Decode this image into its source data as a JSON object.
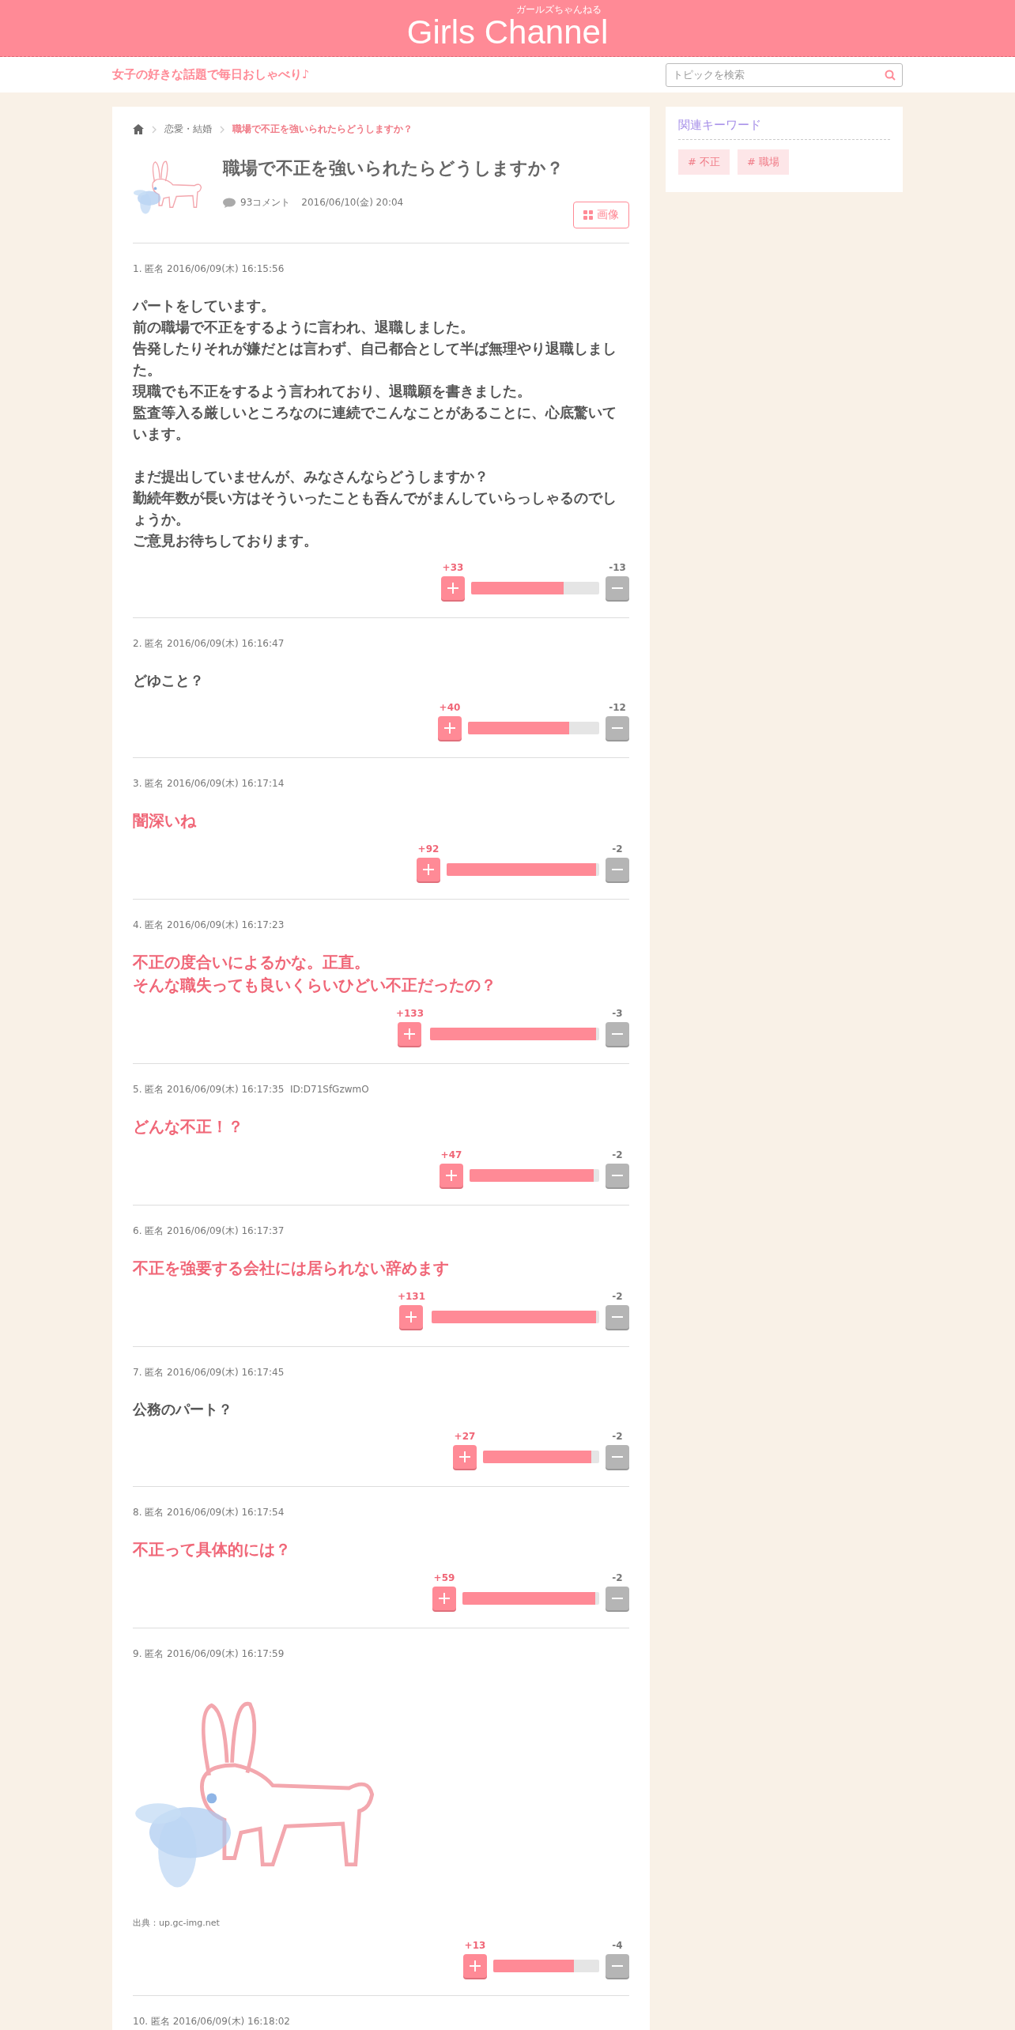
{
  "header": {
    "logo": "Girls Channel",
    "logo_kana": "ガールズちゃんねる",
    "tagline": "女子の好きな話題で毎日おしゃべり♪",
    "search": {
      "placeholder": "トピックを検索"
    }
  },
  "breadcrumb": [
    {
      "label": "恋愛・結婚",
      "current": false
    },
    {
      "label": "職場で不正を強いられたらどうしますか？",
      "current": true
    }
  ],
  "topic": {
    "title": "職場で不正を強いられたらどうしますか？",
    "comment_count": "93コメント",
    "date": "2016/06/10(金) 20:04",
    "image_button": "画像"
  },
  "comments": [
    {
      "kind": "text",
      "meta": "1. 匿名 2016/06/09(木) 16:15:56",
      "highlighted": false,
      "paragraphs": [
        [
          "パートをしています。",
          "前の職場で不正をするように言われ、退職しました。",
          "告発したりそれが嫌だとは言わず、自己都合として半ば無理やり退職しました。",
          "現職でも不正をするよう言われており、退職願を書きました。",
          "監査等入る厳しいところなのに連続でこんなことがあることに、心底驚いています。"
        ],
        [
          "まだ提出していませんが、みなさんならどうしますか？",
          "勤続年数が長い方はそういったことも呑んでがまんしていらっしゃるのでしょうか。",
          "ご意見お待ちしております。"
        ]
      ],
      "plus": "+33",
      "minus": "-13",
      "level": 0.72
    },
    {
      "kind": "text",
      "meta": "2. 匿名 2016/06/09(木) 16:16:47",
      "highlighted": false,
      "paragraphs": [
        [
          "どゆこと？"
        ]
      ],
      "plus": "+40",
      "minus": "-12",
      "level": 0.77
    },
    {
      "kind": "text",
      "meta": "3. 匿名 2016/06/09(木) 16:17:14",
      "highlighted": true,
      "paragraphs": [
        [
          "闇深いね"
        ]
      ],
      "plus": "+92",
      "minus": "-2",
      "level": 0.98
    },
    {
      "kind": "text",
      "meta": "4. 匿名 2016/06/09(木) 16:17:23",
      "highlighted": true,
      "paragraphs": [
        [
          "不正の度合いによるかな。正直。",
          "そんな職失っても良いくらいひどい不正だったの？"
        ]
      ],
      "plus": "+133",
      "minus": "-3",
      "level": 0.98
    },
    {
      "kind": "text",
      "meta": "5. 匿名 2016/06/09(木) 16:17:35  ID:D71SfGzwmO",
      "highlighted": true,
      "paragraphs": [
        [
          "どんな不正！？"
        ]
      ],
      "plus": "+47",
      "minus": "-2",
      "level": 0.96
    },
    {
      "kind": "text",
      "meta": "6. 匿名 2016/06/09(木) 16:17:37",
      "highlighted": true,
      "paragraphs": [
        [
          "不正を強要する会社には居られない辞めます"
        ]
      ],
      "plus": "+131",
      "minus": "-2",
      "level": 0.98
    },
    {
      "kind": "text",
      "meta": "7. 匿名 2016/06/09(木) 16:17:45",
      "highlighted": false,
      "paragraphs": [
        [
          "公務のパート？"
        ]
      ],
      "plus": "+27",
      "minus": "-2",
      "level": 0.93
    },
    {
      "kind": "text",
      "meta": "8. 匿名 2016/06/09(木) 16:17:54",
      "highlighted": true,
      "paragraphs": [
        [
          "不正って具体的には？"
        ]
      ],
      "plus": "+59",
      "minus": "-2",
      "level": 0.97
    },
    {
      "meta": "9. 匿名 2016/06/09(木) 16:17:59",
      "source": "出典：up.gc-img.net",
      "plus": "+13",
      "minus": "-4",
      "level": 0.76
    },
    {
      "kind": "text",
      "meta": "10. 匿名 2016/06/09(木) 16:18:02"
    }
  ],
  "sidebar": {
    "title": "関連キーワード",
    "keywords": [
      "# 不正",
      "# 職場"
    ]
  }
}
